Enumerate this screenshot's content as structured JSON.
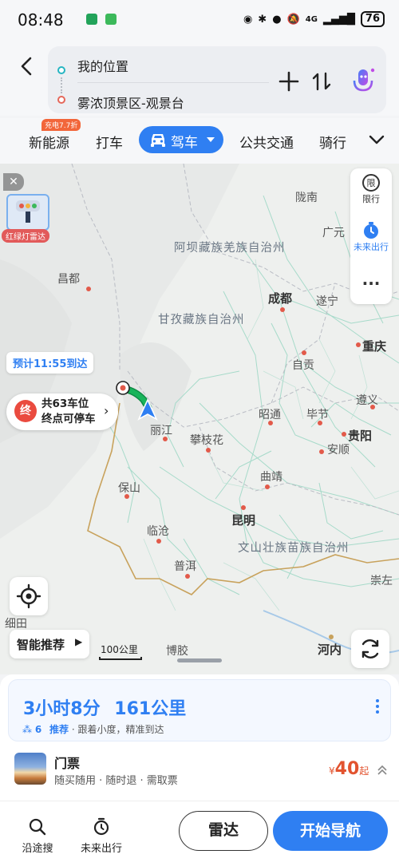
{
  "status_bar": {
    "time": "08:48",
    "network": "4G",
    "battery": "76"
  },
  "route_input": {
    "from": "我的位置",
    "to": "雾浓顶景区-观景台"
  },
  "mode_tabs": {
    "items": [
      "新能源",
      "打车",
      "驾车",
      "公共交通",
      "骑行"
    ],
    "active": "驾车",
    "badge": "充电7.7折"
  },
  "map": {
    "overlay_card_label": "红绿灯雷达",
    "side_panel": {
      "limit_label": "限行",
      "limit_icon_text": "限",
      "future_label": "未来出行"
    },
    "eta_bubble": "预计11:55到达",
    "parking": {
      "end_marker": "终",
      "line1": "共63车位",
      "line2": "终点可停车"
    },
    "smart_recommend": "智能推荐",
    "scale": "100公里",
    "cities": [
      {
        "name": "陇南"
      },
      {
        "name": "广元"
      },
      {
        "name": "昌都"
      },
      {
        "name": "成都"
      },
      {
        "name": "遂宁"
      },
      {
        "name": "重庆"
      },
      {
        "name": "自贡"
      },
      {
        "name": "遵义"
      },
      {
        "name": "丽江"
      },
      {
        "name": "昭通"
      },
      {
        "name": "毕节"
      },
      {
        "name": "攀枝花"
      },
      {
        "name": "贵阳"
      },
      {
        "name": "安顺"
      },
      {
        "name": "保山"
      },
      {
        "name": "曲靖"
      },
      {
        "name": "临沧"
      },
      {
        "name": "昆明"
      },
      {
        "name": "普洱"
      },
      {
        "name": "博胶"
      },
      {
        "name": "河内"
      },
      {
        "name": "崇左"
      },
      {
        "name": "细田"
      }
    ],
    "regions": [
      "阿坝藏族羌族自治州",
      "甘孜藏族自治州",
      "文山壮族苗族自治州"
    ],
    "colors": {
      "route": "#19b45b",
      "accent": "#2f7ff2",
      "city_dot": "#e25a4a",
      "border": "#c8a25c"
    }
  },
  "route_summary": {
    "duration": "3小时8分",
    "distance": "161公里",
    "traffic_lights": "6",
    "tag": "推荐",
    "desc": "· 跟着小度，精准到达"
  },
  "ticket": {
    "title": "门票",
    "desc": "随买随用 · 随时退 · 需取票",
    "currency": "¥",
    "price": "40",
    "suffix": "起"
  },
  "bottom_bar": {
    "along_search": "沿途搜",
    "future_trip": "未来出行",
    "radar": "雷达",
    "start_nav": "开始导航"
  }
}
